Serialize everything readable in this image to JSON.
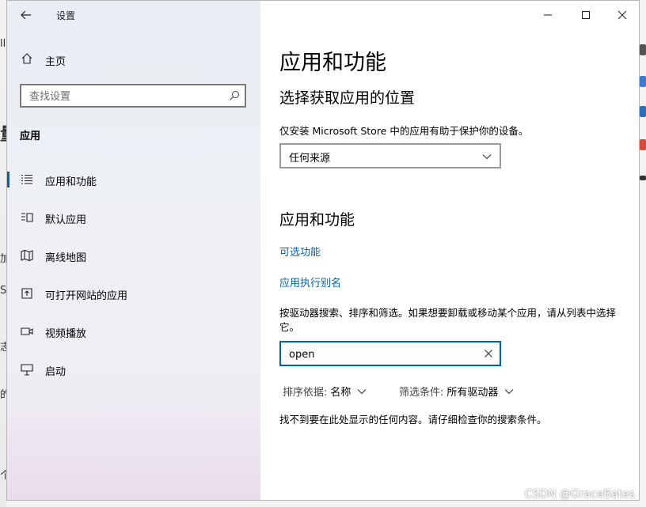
{
  "window": {
    "title": "设置",
    "controls": {
      "minimize": "—",
      "maximize": "☐",
      "close": "✕"
    }
  },
  "sidebar": {
    "home_label": "主页",
    "search_placeholder": "查找设置",
    "section_label": "应用",
    "items": [
      {
        "label": "应用和功能",
        "icon": "apps-list-icon",
        "active": true
      },
      {
        "label": "默认应用",
        "icon": "default-apps-icon",
        "active": false
      },
      {
        "label": "离线地图",
        "icon": "map-icon",
        "active": false
      },
      {
        "label": "可打开网站的应用",
        "icon": "open-website-icon",
        "active": false
      },
      {
        "label": "视频播放",
        "icon": "video-icon",
        "active": false
      },
      {
        "label": "启动",
        "icon": "startup-icon",
        "active": false
      }
    ]
  },
  "main": {
    "title": "应用和功能",
    "location_heading": "选择获取应用的位置",
    "location_desc": "仅安装 Microsoft Store 中的应用有助于保护你的设备。",
    "source_select_value": "任何来源",
    "apps_heading": "应用和功能",
    "link_optional": "可选功能",
    "link_alias": "应用执行别名",
    "search_desc": "按驱动器搜索、排序和筛选。如果想要卸载或移动某个应用，请从列表中选择它。",
    "search_value": "open",
    "sort_label": "排序依据:",
    "sort_value": "名称",
    "filter_label": "筛选条件:",
    "filter_value": "所有驱动器",
    "empty_message": "找不到要在此处显示的任何内容。请仔细检查你的搜索条件。"
  },
  "watermark": "CSDN @GraceBates",
  "colors": {
    "accent": "#0063b1",
    "link": "#0063b1"
  }
}
